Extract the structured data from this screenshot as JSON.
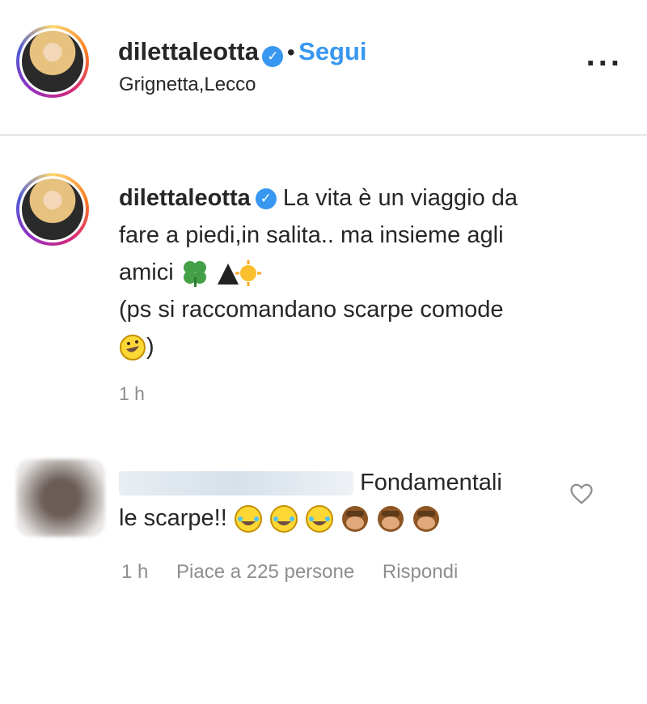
{
  "post_header": {
    "username": "dilettaleotta",
    "separator": "•",
    "follow_label": "Segui",
    "location": "Grignetta,Lecco",
    "more_label": "..."
  },
  "caption": {
    "username": "dilettaleotta",
    "line1": "La vita è un viaggio da",
    "line2": "fare a piedi,in salita.. ma insieme agli",
    "line3": "amici",
    "line4": "(ps si raccomandano scarpe comode",
    "line5_end": ")",
    "time": "1 h"
  },
  "comment": {
    "text1": "Fondamentali",
    "text2": "le scarpe!!",
    "time": "1 h",
    "likes": "Piace a 225 persone",
    "reply": "Rispondi"
  },
  "colors": {
    "accent": "#3897f0",
    "muted": "#8e8e8e"
  }
}
